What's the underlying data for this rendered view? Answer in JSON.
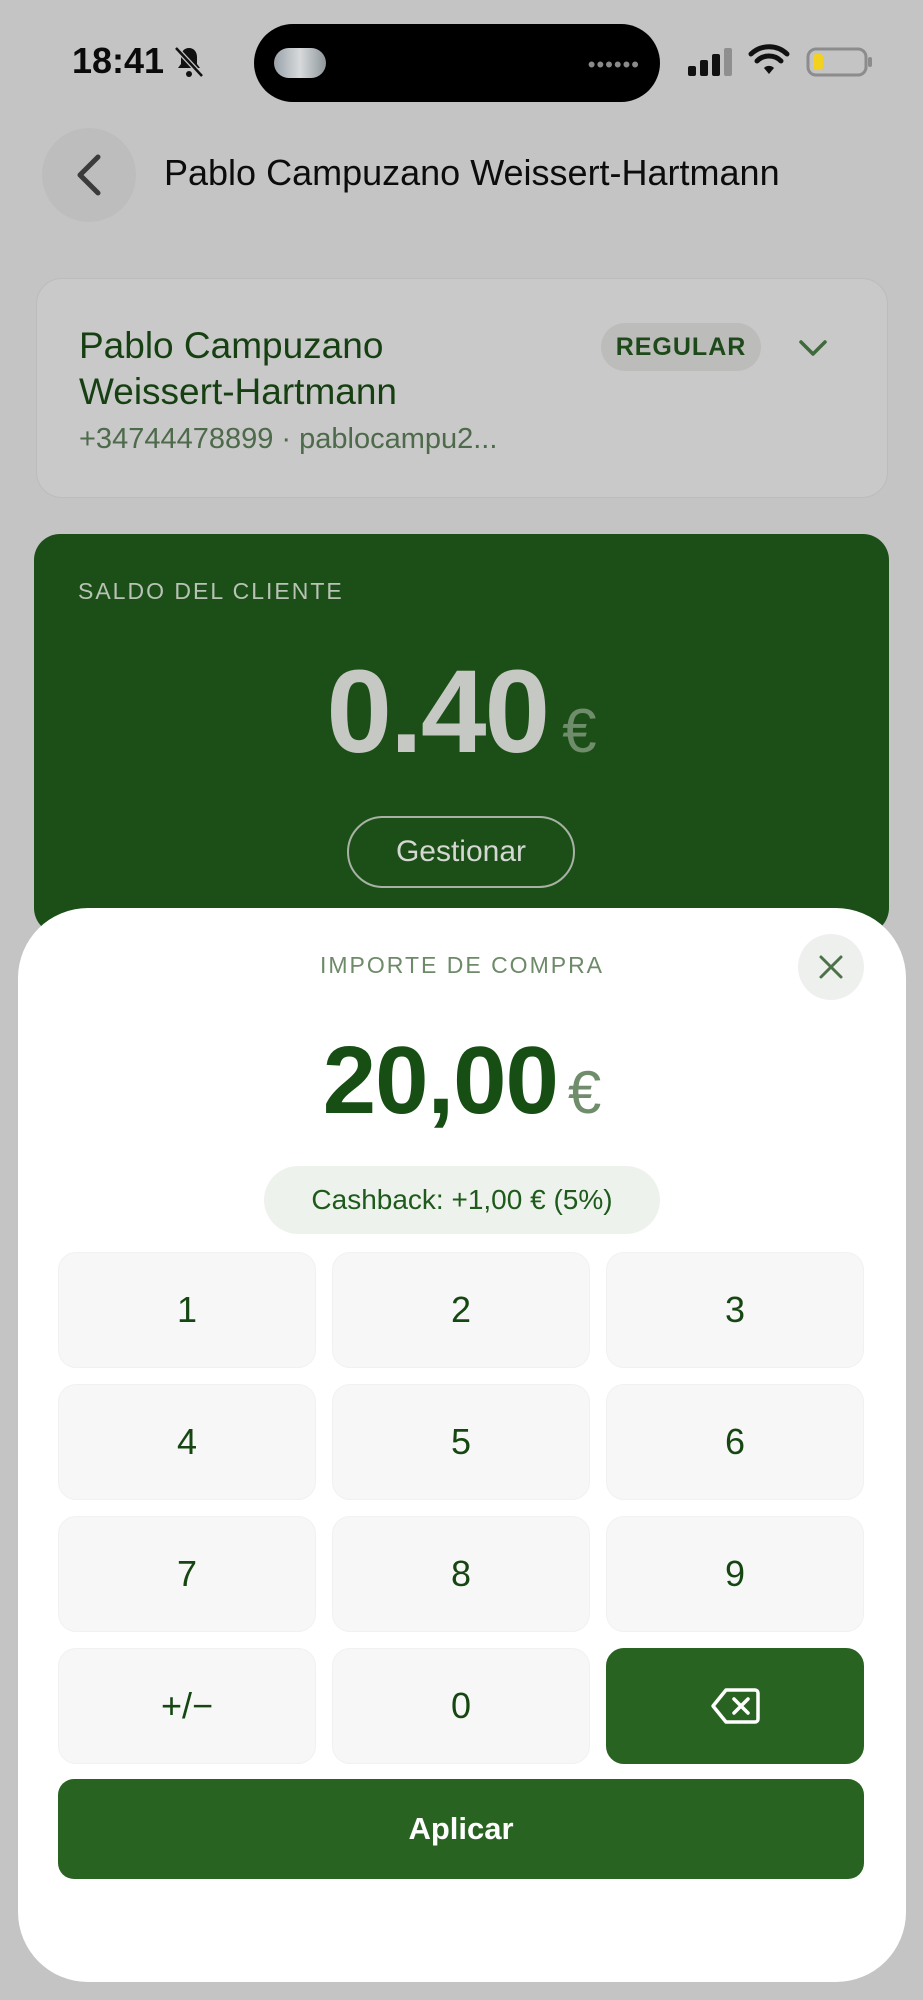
{
  "status_bar": {
    "time": "18:41"
  },
  "header": {
    "title": "Pablo Campuzano Weissert-Hartmann"
  },
  "profile": {
    "name": "Pablo Campuzano Weissert-Hartmann",
    "contact": "+34744478899 · pablocampu2...",
    "badge": "REGULAR"
  },
  "balance": {
    "label": "SALDO DEL CLIENTE",
    "value": "0.40",
    "currency": "€",
    "manage_label": "Gestionar"
  },
  "sheet": {
    "title": "IMPORTE DE COMPRA",
    "amount": "20,00",
    "currency": "€",
    "cashback": "Cashback: +1,00 € (5%)",
    "keys": [
      "1",
      "2",
      "3",
      "4",
      "5",
      "6",
      "7",
      "8",
      "9",
      "+/−",
      "0"
    ],
    "apply_label": "Aplicar"
  },
  "colors": {
    "brand_green": "#296321",
    "balance_bg": "#1c4f18",
    "text_green": "#164712"
  }
}
